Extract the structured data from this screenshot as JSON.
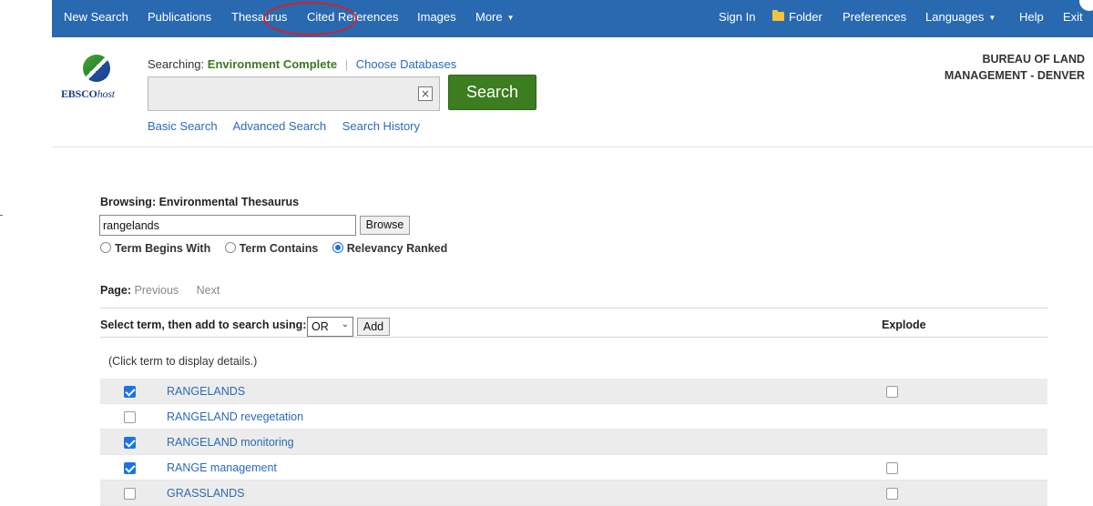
{
  "nav": {
    "items": [
      {
        "label": "New Search"
      },
      {
        "label": "Publications"
      },
      {
        "label": "Thesaurus"
      },
      {
        "label": "Cited References"
      },
      {
        "label": "Images"
      },
      {
        "label": "More"
      }
    ],
    "right_items": [
      {
        "label": "Sign In"
      },
      {
        "label": "Folder"
      },
      {
        "label": "Preferences"
      },
      {
        "label": "Languages"
      },
      {
        "label": "Help"
      },
      {
        "label": "Exit"
      }
    ]
  },
  "header": {
    "logo_brand": "EBSCO",
    "logo_suffix": "host",
    "searching_label": "Searching:",
    "database": "Environment Complete",
    "choose_databases": "Choose Databases",
    "search_value": "",
    "search_button": "Search",
    "clear_icon": "close-icon",
    "links": [
      "Basic Search",
      "Advanced Search",
      "Search History"
    ],
    "org_line1": "BUREAU OF LAND",
    "org_line2": "MANAGEMENT - DENVER"
  },
  "browse": {
    "label": "Browsing: Environmental Thesaurus",
    "input_value": "rangelands",
    "button": "Browse",
    "options": [
      {
        "label": "Term Begins With",
        "checked": false
      },
      {
        "label": "Term Contains",
        "checked": false
      },
      {
        "label": "Relevancy Ranked",
        "checked": true
      }
    ]
  },
  "pager": {
    "label": "Page:",
    "previous": "Previous",
    "next": "Next"
  },
  "actions": {
    "select_label": "Select term, then add to search using:",
    "operator": "OR",
    "add_button": "Add",
    "explode_label": "Explode"
  },
  "hint": "(Click term to display details.)",
  "terms": [
    {
      "label": "RANGELANDS",
      "checked": true,
      "explode": true
    },
    {
      "label": "RANGELAND revegetation",
      "checked": false,
      "explode": false
    },
    {
      "label": "RANGELAND monitoring",
      "checked": true,
      "explode": false
    },
    {
      "label": "RANGE management",
      "checked": true,
      "explode": true
    },
    {
      "label": "GRASSLANDS",
      "checked": false,
      "explode": true
    }
  ],
  "colors": {
    "nav_bg": "#2969b0",
    "search_button": "#3b7d1f",
    "database_text": "#3a7a22",
    "link": "#2a6bb5",
    "highlight": "#d4212a"
  }
}
